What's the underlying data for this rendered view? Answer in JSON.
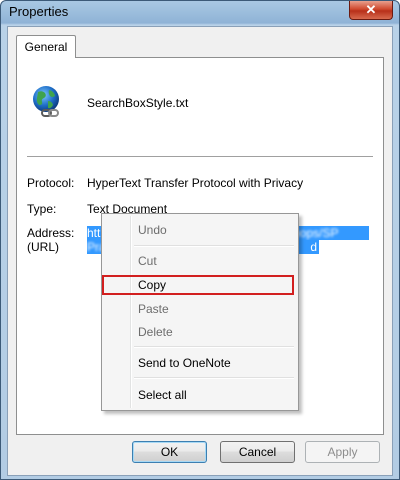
{
  "window": {
    "title": "Properties",
    "close_glyph": "✕"
  },
  "tabs": [
    {
      "label": "General"
    }
  ],
  "file": {
    "name": "SearchBoxStyle.txt",
    "icon": "globe-link-icon"
  },
  "fields": {
    "protocol_label": "Protocol:",
    "protocol_value": "HyperText Transfer Protocol with Privacy",
    "type_label": "Type:",
    "type_value": "Text Document",
    "address_label": "Address:",
    "address_label2": "(URL)",
    "url_line1": "https://",
    "url_line1_blurred": "gweb.greenfield.com/us/104/archops/SP",
    "url_line2_blurred": "Pra",
    "url_line2_tail": "d"
  },
  "context_menu": {
    "items": [
      {
        "label": "Undo",
        "enabled": false
      },
      {
        "label": "Cut",
        "enabled": false
      },
      {
        "label": "Copy",
        "enabled": true,
        "highlighted": true
      },
      {
        "label": "Paste",
        "enabled": false
      },
      {
        "label": "Delete",
        "enabled": false
      },
      {
        "label": "Send to OneNote",
        "enabled": true
      },
      {
        "label": "Select all",
        "enabled": true
      }
    ],
    "highlight_color": "#d21f1f"
  },
  "buttons": {
    "ok": "OK",
    "cancel": "Cancel",
    "apply": "Apply"
  },
  "colors": {
    "selection": "#3399ff",
    "title_bar": "#a9c8e3"
  }
}
